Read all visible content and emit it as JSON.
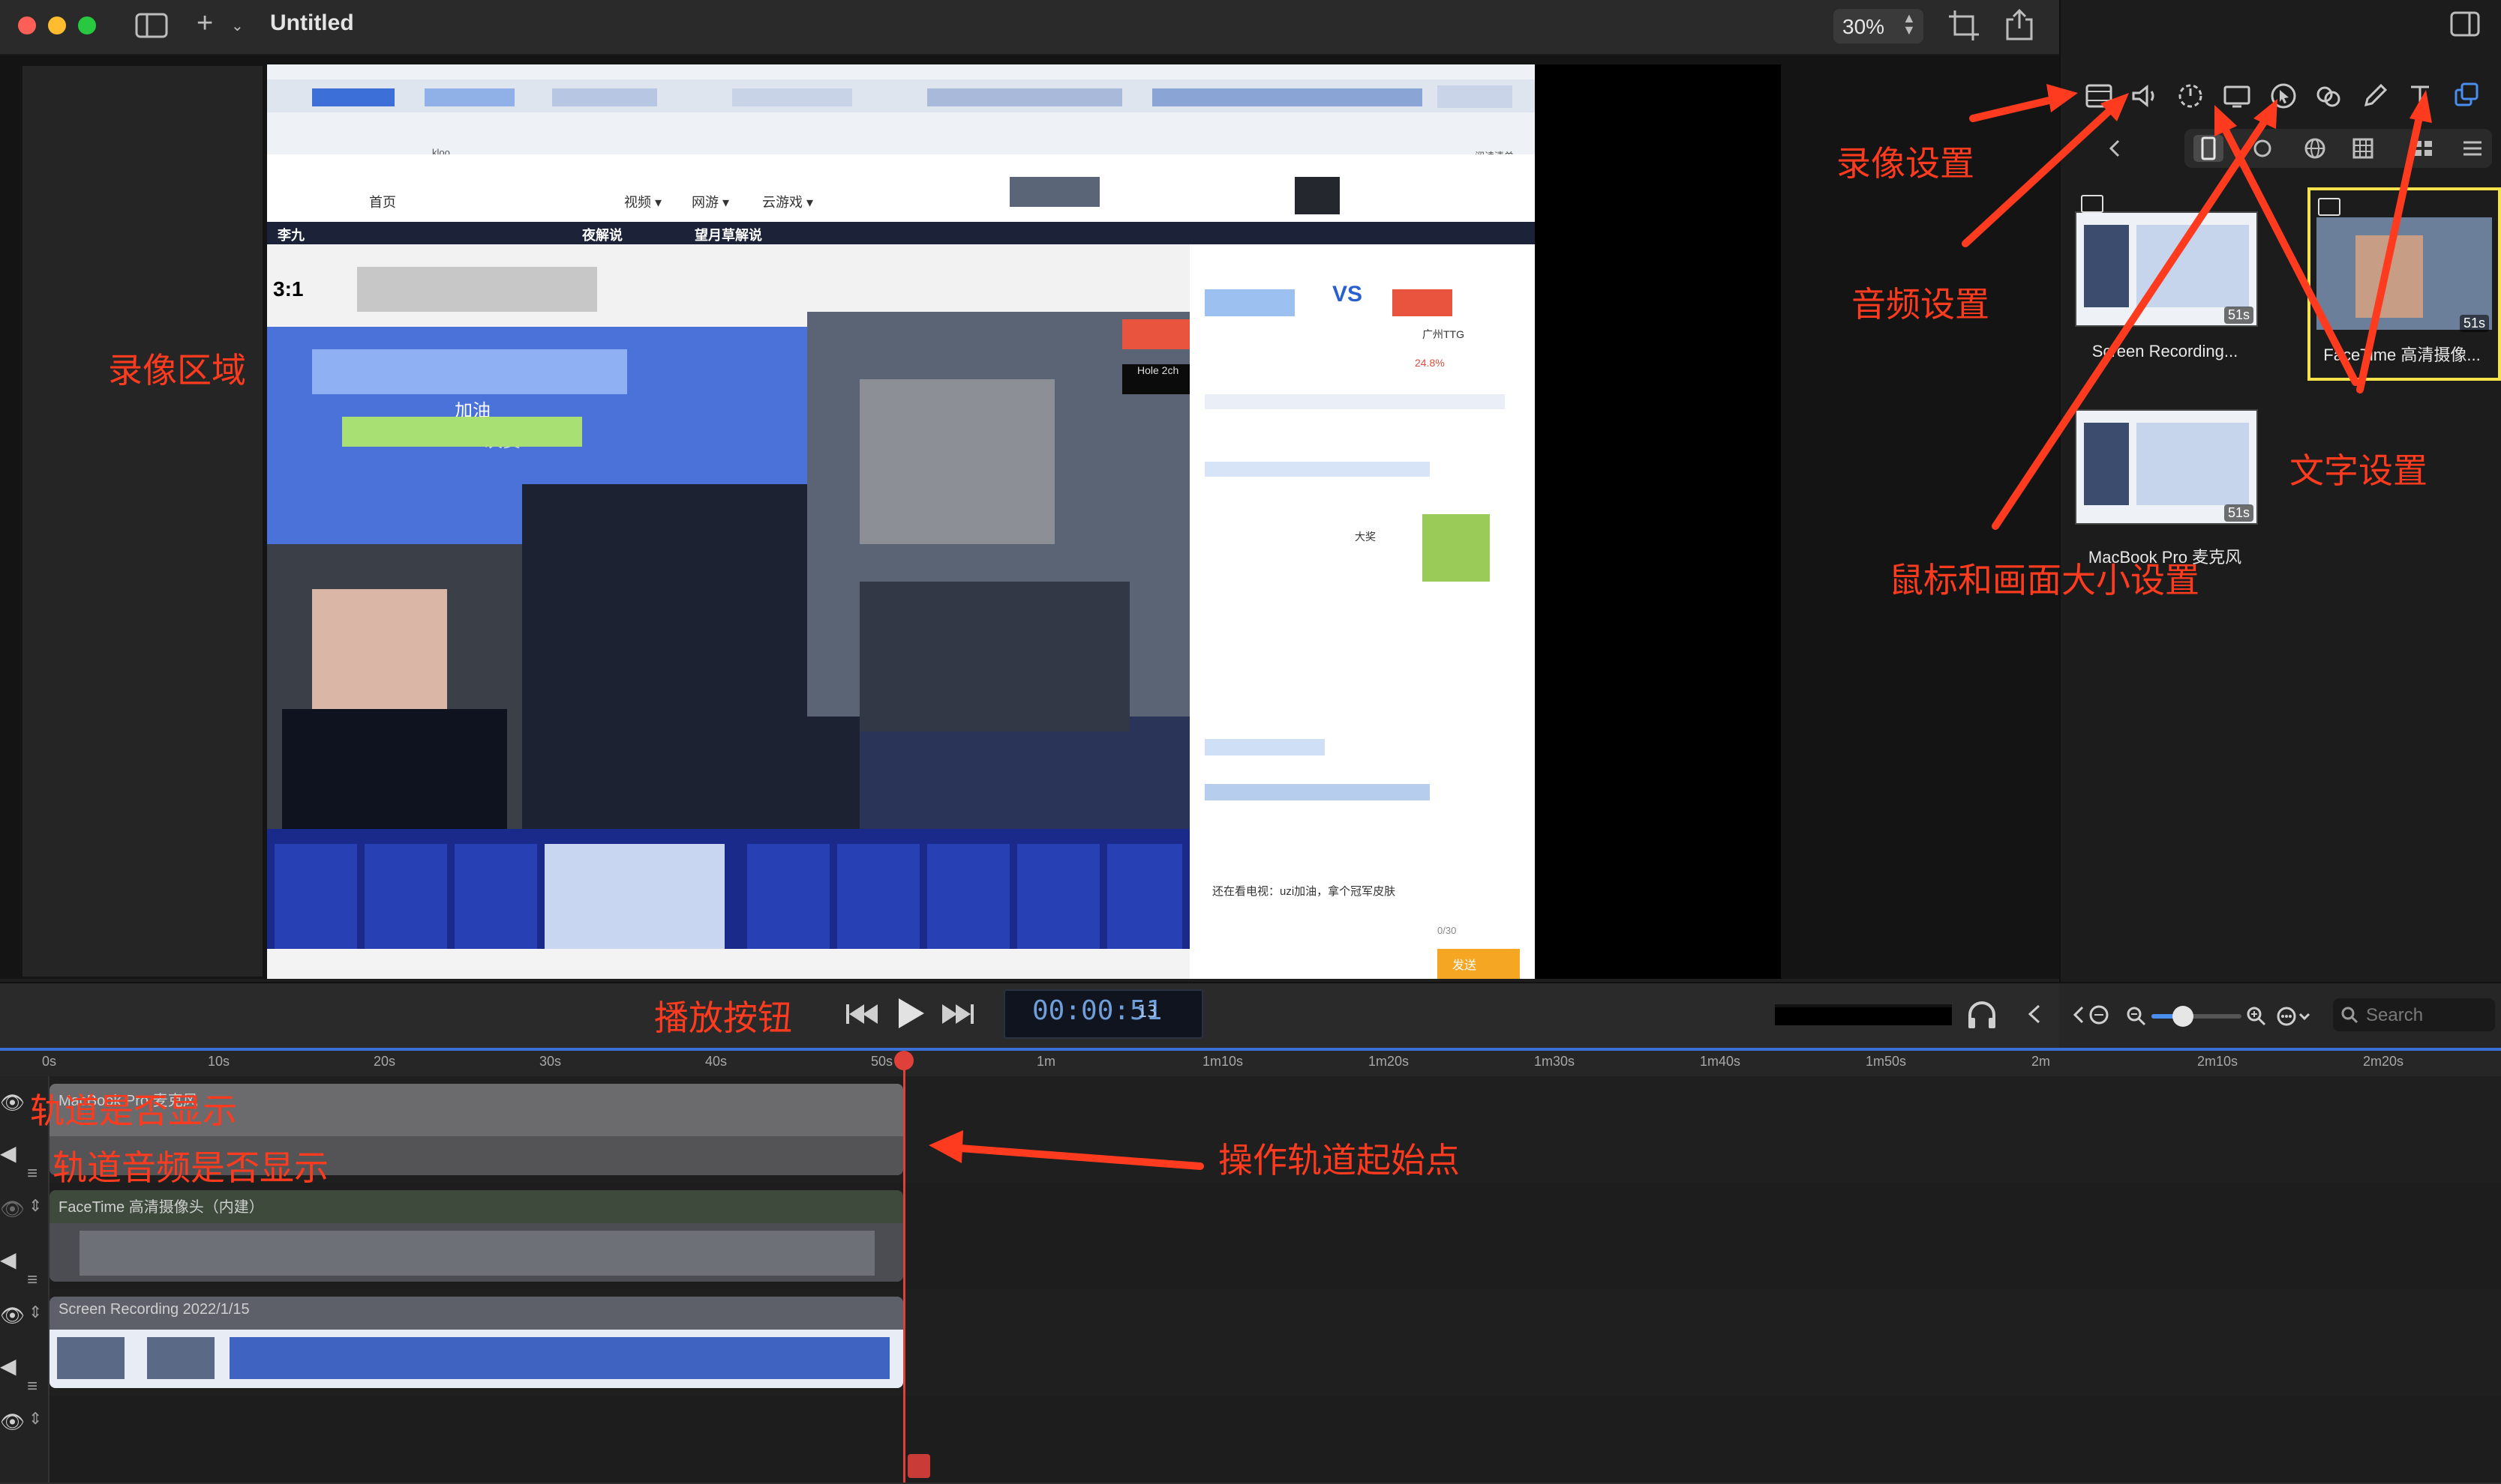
{
  "window": {
    "title": "Untitled",
    "zoom": "30%"
  },
  "colors": {
    "accent": "#4a8ef0",
    "annotation": "#ff3b1f",
    "playhead": "#e0403a",
    "selection": "#f6e24a"
  },
  "icons": {
    "toolbar": [
      "sidebar-toggle-icon",
      "add-icon",
      "crop-icon",
      "share-icon"
    ],
    "inspector_tabs": [
      "video-settings-icon",
      "audio-settings-icon",
      "record-timer-icon",
      "screen-size-icon",
      "cursor-icon",
      "effects-icon",
      "annotate-pen-icon",
      "text-icon",
      "layers-icon"
    ]
  },
  "media": [
    {
      "label": "Screen Recording...",
      "duration": "51s"
    },
    {
      "label": "FaceTime 高清摄像...",
      "duration": "51s"
    },
    {
      "label": "MacBook Pro 麦克风",
      "duration": "51s"
    }
  ],
  "transport": {
    "timecode": "00:00:51",
    "frames": "13",
    "search_placeholder": "Search"
  },
  "ruler": [
    "0s",
    "10s",
    "20s",
    "30s",
    "40s",
    "50s",
    "1m",
    "1m10s",
    "1m20s",
    "1m30s",
    "1m40s",
    "1m50s",
    "2m",
    "2m10s",
    "2m20s"
  ],
  "tracks": [
    {
      "name": "MacBook Pro 麦克风",
      "type": "audio"
    },
    {
      "name": "FaceTime 高清摄像头（内建）",
      "type": "camera"
    },
    {
      "name": "Screen Recording 2022/1/15",
      "type": "screen"
    }
  ],
  "annotations": {
    "record_settings": "录像设置",
    "audio_settings": "音频设置",
    "record_area": "录像区域",
    "text_settings": "文字设置",
    "cursor_size": "鼠标和画面大小设置",
    "play_button": "播放按钮",
    "track_visible": "轨道是否显示",
    "track_audio_visible": "轨道音频是否显示",
    "track_start": "操作轨道起始点"
  },
  "preview_text": {
    "tab_kloo": "kloo",
    "nav_home": "首页",
    "nav_video": "视频 ▾",
    "nav_online": "网游 ▾",
    "nav_cloud": "云游戏 ▾",
    "read_list": "阅读清单",
    "host_name": "李九",
    "night_commentary": "夜解说",
    "commentary": "望月草解说",
    "score": "3:1",
    "cheer": "加油",
    "win": "决赛",
    "vs": "VS",
    "team": "广州TTG",
    "percent": "24.8%",
    "chat_line": "还在看电视：uzi加油，拿个冠军皮肤",
    "award": "大奖",
    "hole": "Hole 2ch",
    "send": "发送",
    "counter": "0/30"
  }
}
